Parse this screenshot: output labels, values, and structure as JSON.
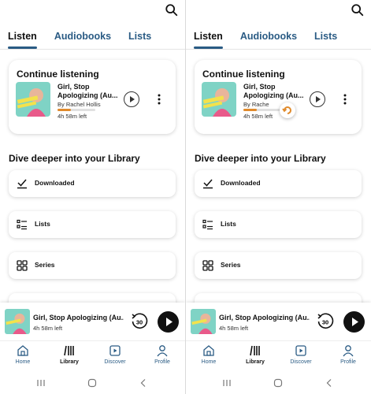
{
  "tabs": [
    "Listen",
    "Audiobooks",
    "Lists"
  ],
  "continue": {
    "heading": "Continue listening",
    "book_title": "Girl, Stop Apologizing (Au...",
    "author": "By Rachel Hollis",
    "author_partial": "By Rache",
    "time_left": "4h 58m left",
    "progress": 0.35
  },
  "library": {
    "heading": "Dive deeper into your Library",
    "items": [
      "Downloaded",
      "Lists",
      "Series"
    ]
  },
  "mini_player": {
    "title": "Girl, Stop Apologizing (Au...",
    "time_left": "4h 58m left",
    "rewind_seconds": "30"
  },
  "nav": [
    "Home",
    "Library",
    "Discover",
    "Profile"
  ],
  "colors": {
    "accent": "#2a5b84",
    "progress": "#e08a2b"
  },
  "cover_text": "GIRL, STOP APOLOGIZING"
}
